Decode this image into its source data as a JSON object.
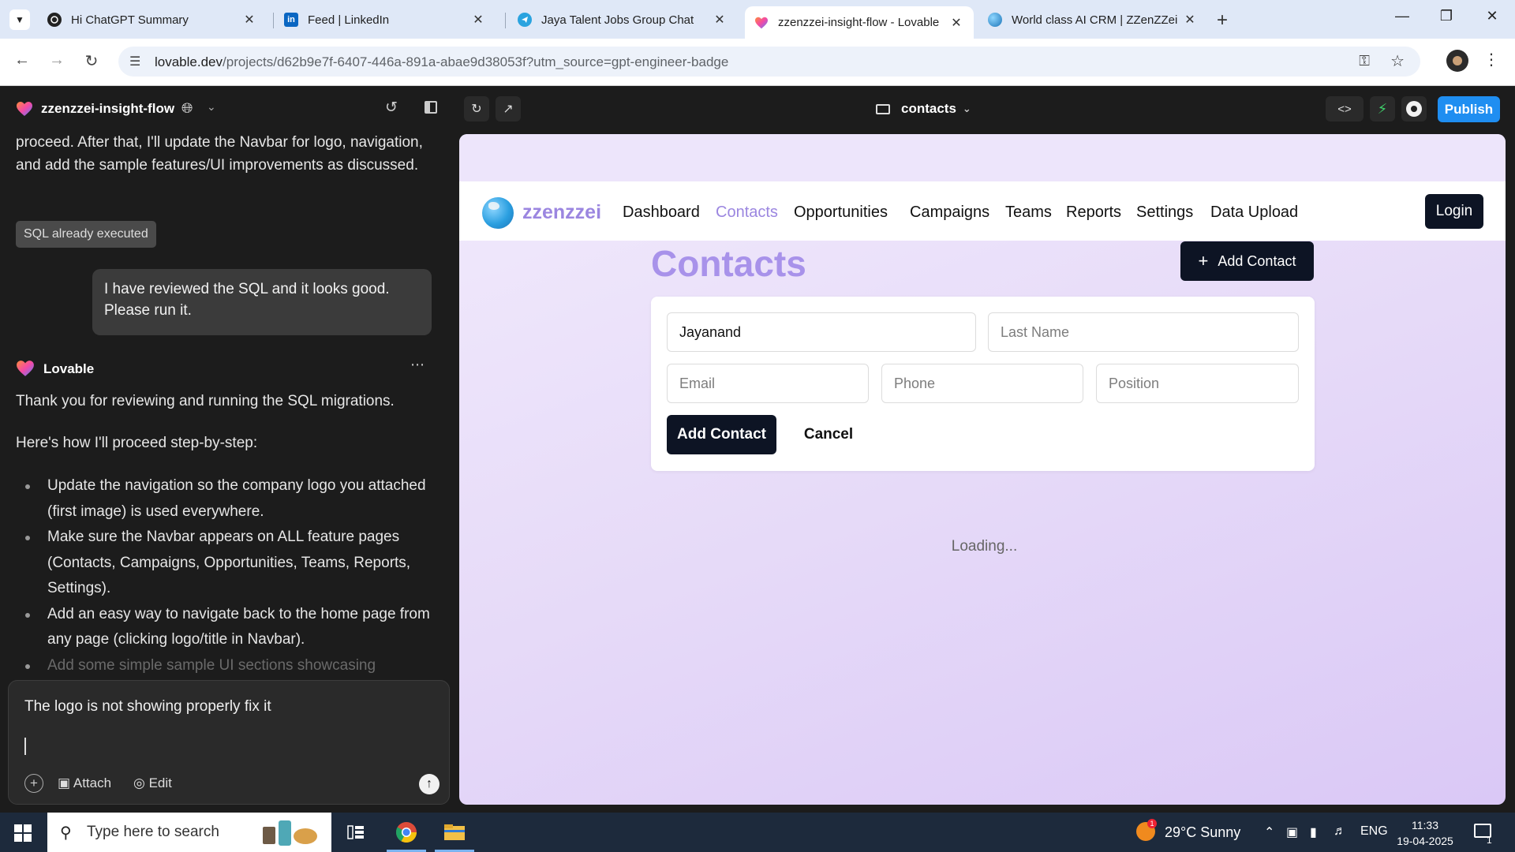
{
  "browser": {
    "tabs": [
      {
        "title": "Hi ChatGPT Summary",
        "icon": "chatgpt-icon",
        "active": false
      },
      {
        "title": "Feed | LinkedIn",
        "icon": "linkedin-icon",
        "active": false
      },
      {
        "title": "Jaya Talent Jobs Group Chat",
        "icon": "telegram-icon",
        "active": false
      },
      {
        "title": "zzenzzei-insight-flow - Lovable",
        "icon": "lovable-heart-icon",
        "active": true
      },
      {
        "title": "World class AI CRM | ZZenZZei",
        "icon": "globe-icon",
        "active": false
      }
    ],
    "url_host": "lovable.dev",
    "url_path": "/projects/d62b9e7f-6407-446a-891a-abae9d38053f?utm_source=gpt-engineer-badge"
  },
  "lovable": {
    "project_name": "zzenzzei-insight-flow",
    "chat": {
      "prev_message": "proceed. After that, I'll update the Navbar for logo, navigation, and add the sample features/UI improvements as discussed.",
      "sql_badge": "SQL already executed",
      "user_message": "I have reviewed the SQL and it looks good. Please run it.",
      "assistant_name": "Lovable",
      "assistant_intro": "Thank you for reviewing and running the SQL migrations.",
      "assistant_steps_intro": "Here's how I'll proceed step-by-step:",
      "bullets": [
        "Update the navigation so the company logo you attached (first image) is used everywhere.",
        "Make sure the Navbar appears on ALL feature pages (Contacts, Campaigns, Opportunities, Teams, Reports, Settings).",
        "Add an easy way to navigate back to the home page from any page (clicking logo/title in Navbar).",
        "Add some simple sample UI sections showcasing"
      ]
    },
    "composer": {
      "text": "The logo is not showing properly fix it",
      "attach_label": "Attach",
      "edit_label": "Edit"
    },
    "toolbar": {
      "route": "contacts",
      "publish_label": "Publish"
    }
  },
  "app": {
    "brand": "zzenzzei",
    "nav": [
      "Dashboard",
      "Contacts",
      "Opportunities",
      "Campaigns",
      "Teams",
      "Reports",
      "Settings",
      "Data Upload"
    ],
    "active_nav": "Contacts",
    "login_label": "Login",
    "page_title": "Contacts",
    "add_contact_label": "Add Contact",
    "form": {
      "first_name_value": "Jayanand",
      "last_name_placeholder": "Last Name",
      "email_placeholder": "Email",
      "phone_placeholder": "Phone",
      "position_placeholder": "Position",
      "submit_label": "Add Contact",
      "cancel_label": "Cancel"
    },
    "loading_text": "Loading..."
  },
  "taskbar": {
    "search_placeholder": "Type here to search",
    "weather": "29°C  Sunny",
    "language": "ENG",
    "time": "11:33",
    "date": "19-04-2025",
    "notification_count": "1"
  },
  "colors": {
    "accent_purple": "#a892ea",
    "dark_button": "#0d1424",
    "publish_blue": "#1f8ef1"
  }
}
